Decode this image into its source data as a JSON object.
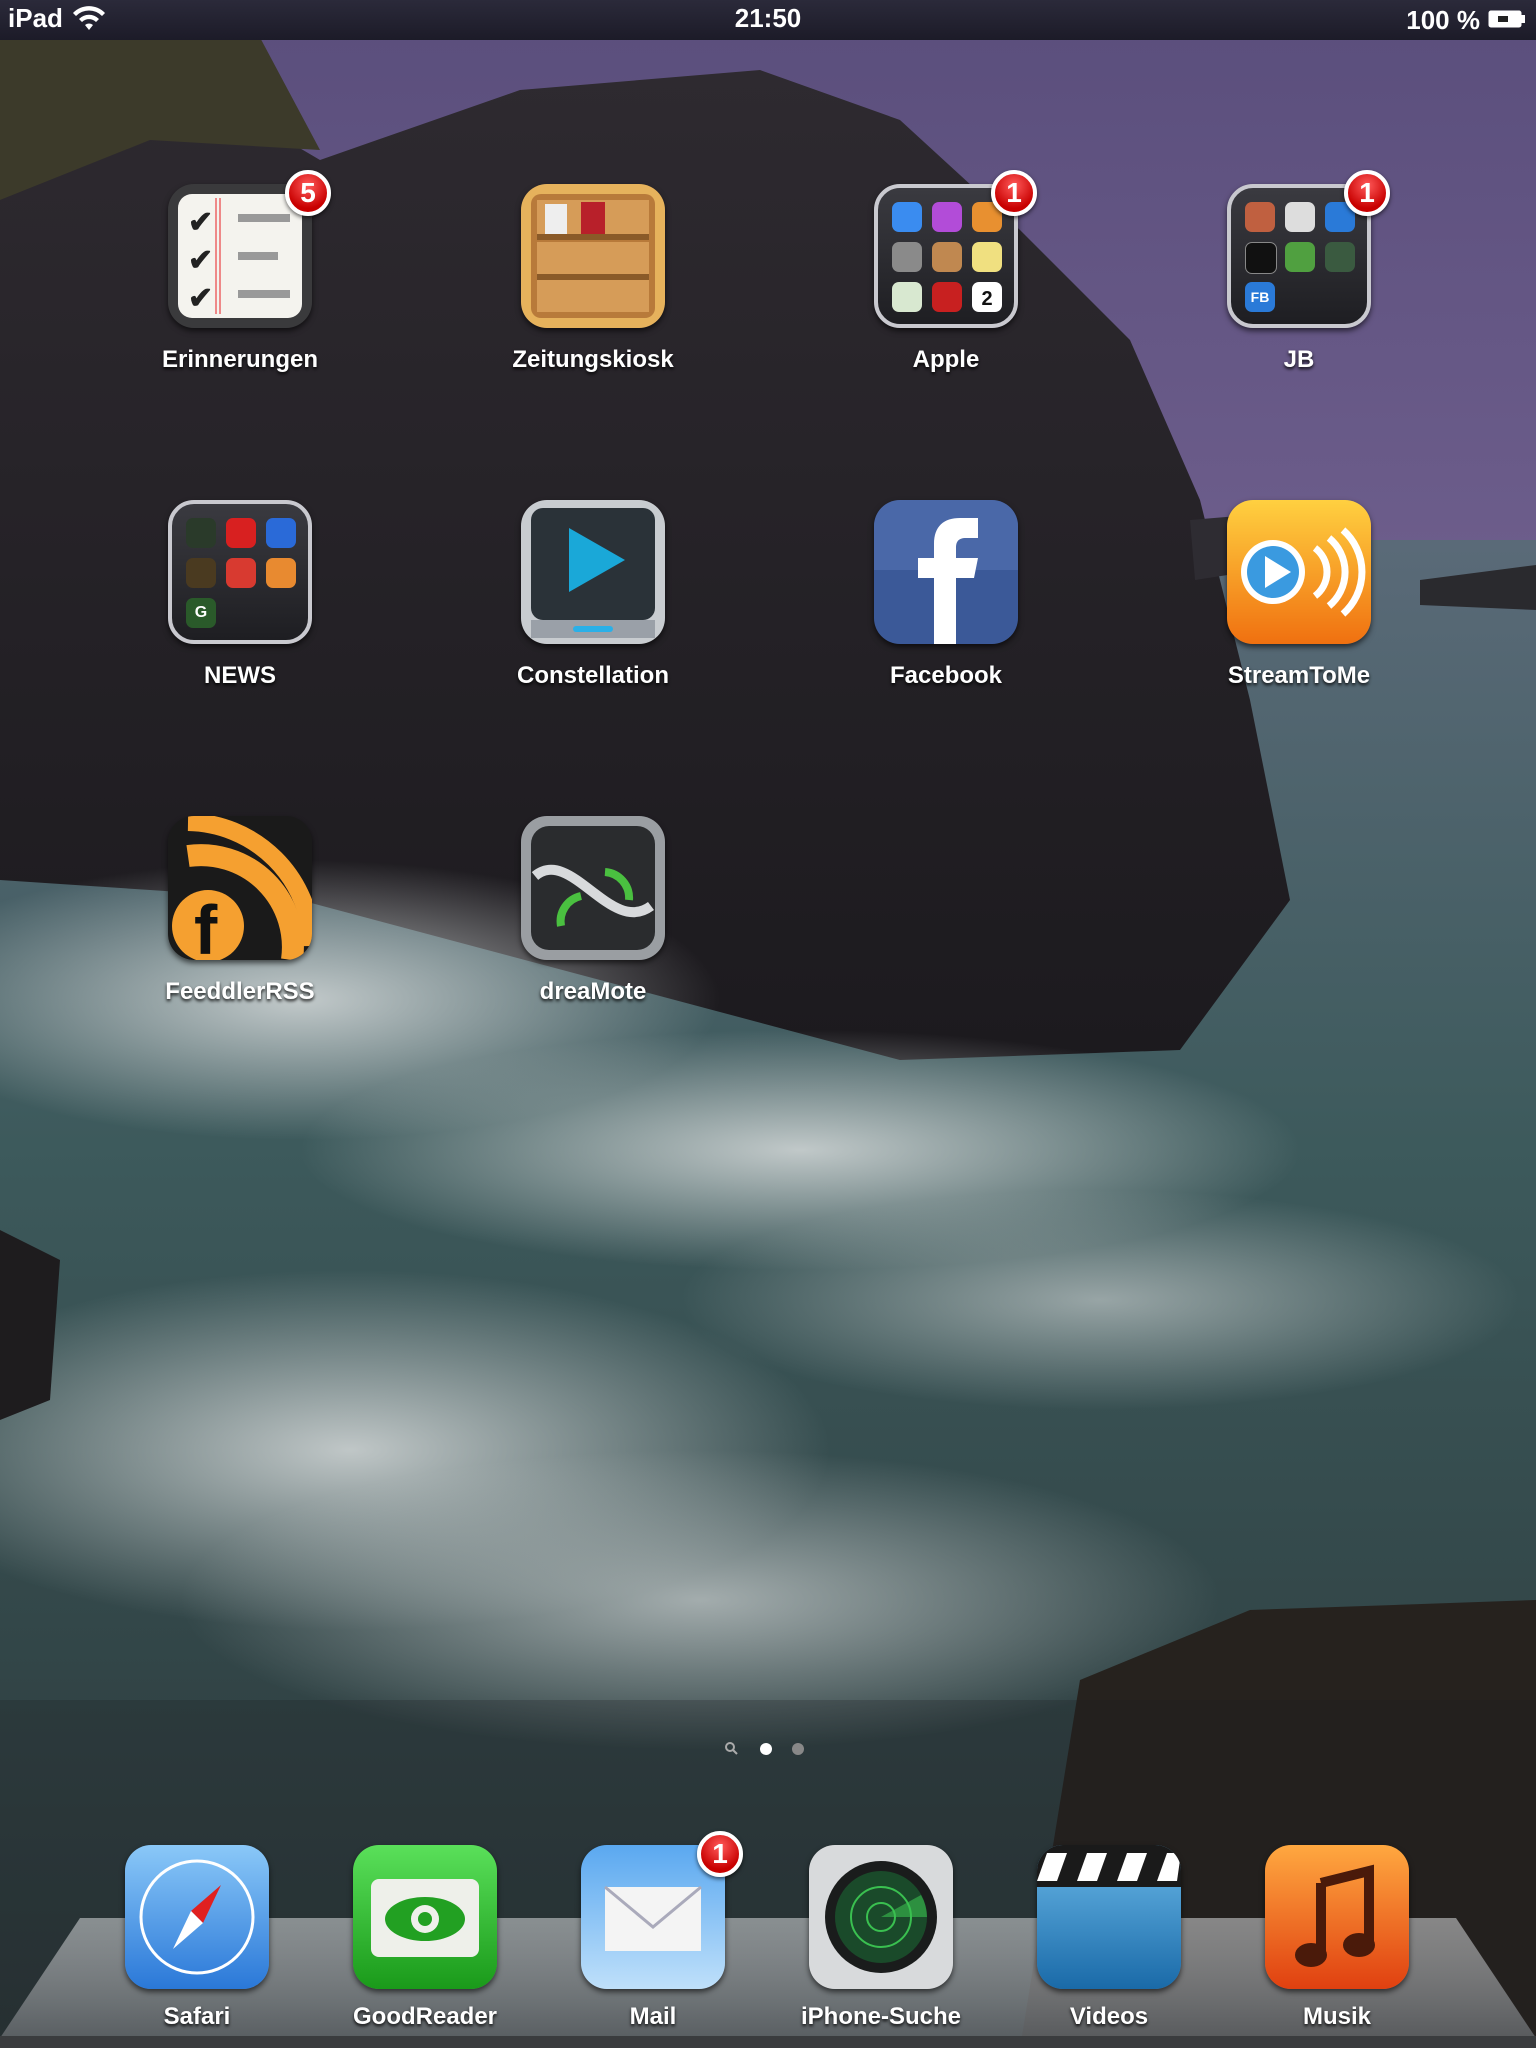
{
  "status_bar": {
    "device": "iPad",
    "time": "21:50",
    "battery_percent": "100 %"
  },
  "home": {
    "apps": [
      {
        "label": "Erinnerungen",
        "badge": "5"
      },
      {
        "label": "Zeitungskiosk"
      },
      {
        "label": "Apple",
        "badge": "1",
        "type": "folder"
      },
      {
        "label": "JB",
        "badge": "1",
        "type": "folder"
      },
      {
        "label": "NEWS",
        "type": "folder"
      },
      {
        "label": "Constellation"
      },
      {
        "label": "Facebook"
      },
      {
        "label": "StreamToMe"
      },
      {
        "label": "FeeddlerRSS"
      },
      {
        "label": "dreaMote"
      }
    ]
  },
  "page_indicator": {
    "pages": 3,
    "current": 1,
    "search_icon": "spotlight-search-icon"
  },
  "dock": {
    "apps": [
      {
        "label": "Safari"
      },
      {
        "label": "GoodReader"
      },
      {
        "label": "Mail",
        "badge": "1"
      },
      {
        "label": "iPhone-Suche"
      },
      {
        "label": "Videos"
      },
      {
        "label": "Musik"
      }
    ]
  },
  "folder_contents": {
    "apple_calendar_day": "2",
    "jb_fb_label": "FB",
    "news_g_label": "G"
  }
}
